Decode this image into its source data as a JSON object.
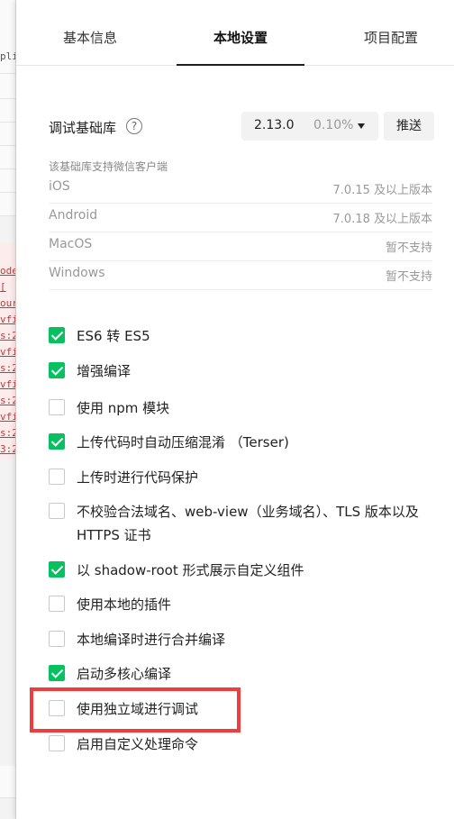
{
  "tabs": [
    {
      "label": "基本信息"
    },
    {
      "label": "本地设置"
    },
    {
      "label": "项目配置"
    }
  ],
  "library": {
    "label": "调试基础库",
    "help_glyph": "?",
    "version": "2.13.0",
    "percent": "0.10%",
    "push_label": "推送"
  },
  "support": {
    "note": "该基础库支持微信客户端",
    "platforms": [
      {
        "name": "iOS",
        "value": "7.0.15 及以上版本"
      },
      {
        "name": "Android",
        "value": "7.0.18 及以上版本"
      },
      {
        "name": "MacOS",
        "value": "暂不支持"
      },
      {
        "name": "Windows",
        "value": "暂不支持"
      }
    ]
  },
  "options": [
    {
      "label": "ES6 转 ES5",
      "checked": true
    },
    {
      "label": "增强编译",
      "checked": true
    },
    {
      "label": "使用 npm 模块",
      "checked": false
    },
    {
      "label": "上传代码时自动压缩混淆 （Terser)",
      "checked": true
    },
    {
      "label": "上传时进行代码保护",
      "checked": false
    },
    {
      "label": "不校验合法域名、web-view（业务域名）、TLS 版本以及 HTTPS 证书",
      "checked": false
    },
    {
      "label": "以 shadow-root 形式展示自定义组件",
      "checked": true
    },
    {
      "label": "使用本地的插件",
      "checked": false
    },
    {
      "label": "本地编译时进行合并编译",
      "checked": false
    },
    {
      "label": "启动多核心编译",
      "checked": true
    },
    {
      "label": "使用独立域进行调试",
      "checked": false
    },
    {
      "label": "启用自定义处理命令",
      "checked": false
    }
  ],
  "background": {
    "text": "pli",
    "error_lines": [
      "ode",
      "[",
      "our",
      "vfi",
      "s:2",
      "vfi",
      "s:2",
      "vfi",
      "s:2",
      "vfi",
      "s:2",
      "3:2"
    ]
  },
  "colors": {
    "check_green": "#07c160",
    "highlight_red": "#ee3d3d"
  }
}
